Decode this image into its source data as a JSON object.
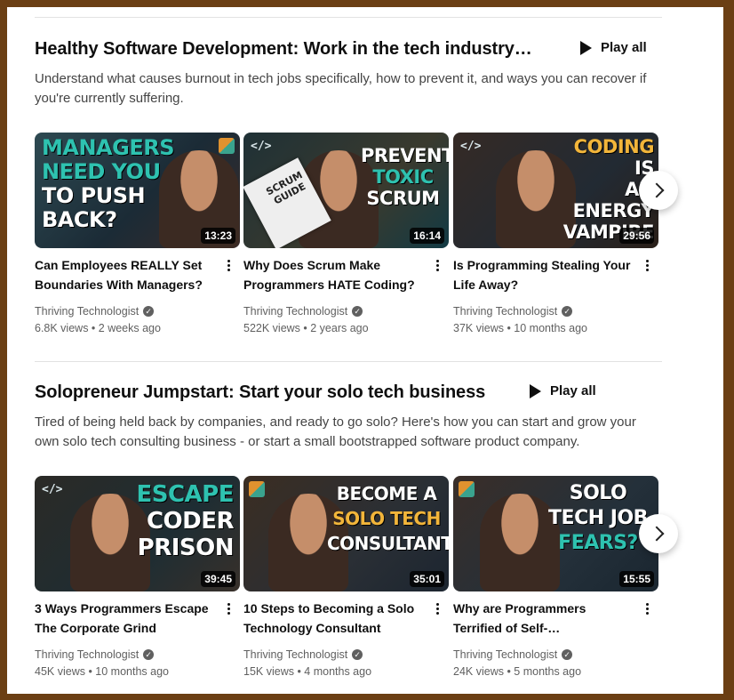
{
  "sections": [
    {
      "title": "Healthy Software Development: Work in the tech industry…",
      "play_all": "Play all",
      "description": "Understand what causes burnout in tech jobs specifically, how to prevent it, and ways you can recover if you're currently suffering.",
      "videos": [
        {
          "title": "Can Employees REALLY Set Boundaries With Managers?",
          "duration": "13:23",
          "channel": "Thriving Technologist",
          "meta": "6.8K views • 2 weeks ago",
          "thumb_lines": [
            "MANAGERS",
            "NEED YOU",
            "TO PUSH",
            "BACK?"
          ]
        },
        {
          "title": "Why Does Scrum Make Programmers HATE Coding?",
          "duration": "16:14",
          "channel": "Thriving Technologist",
          "meta": "522K views • 2 years ago",
          "thumb_lines": [
            "PREVENT",
            "TOXIC",
            "SCRUM"
          ],
          "thumb_note": "SCRUM GUIDE"
        },
        {
          "title": "Is Programming Stealing Your Life Away?",
          "duration": "29:56",
          "channel": "Thriving Technologist",
          "meta": "37K views • 10 months ago",
          "thumb_lines": [
            "CODING",
            "IS",
            "AN ENERGY",
            "VAMPIRE"
          ]
        }
      ]
    },
    {
      "title": "Solopreneur Jumpstart: Start your solo tech business",
      "play_all": "Play all",
      "description": "Tired of being held back by companies, and ready to go solo? Here's how you can start and grow your own solo tech consulting business - or start a small bootstrapped software product company.",
      "videos": [
        {
          "title": "3 Ways Programmers Escape The Corporate Grind",
          "duration": "39:45",
          "channel": "Thriving Technologist",
          "meta": "45K views • 10 months ago",
          "thumb_lines": [
            "ESCAPE",
            "CODER",
            "PRISON"
          ]
        },
        {
          "title": "10 Steps to Becoming a Solo Technology Consultant",
          "duration": "35:01",
          "channel": "Thriving Technologist",
          "meta": "15K views • 4 months ago",
          "thumb_lines": [
            "BECOME A",
            "SOLO TECH",
            "CONSULTANT"
          ]
        },
        {
          "title": "Why are Programmers Terrified of Self-…",
          "duration": "15:55",
          "channel": "Thriving Technologist",
          "meta": "24K views • 5 months ago",
          "thumb_lines": [
            "SOLO",
            "TECH JOB",
            "FEARS?"
          ]
        }
      ]
    }
  ],
  "icons": {
    "verified": "check-circle-icon",
    "kebab": "more-vert-icon",
    "next": "chevron-right-icon",
    "play": "play-icon",
    "code": "code-brackets-icon",
    "logo": "channel-logo-icon"
  },
  "glyphs": {
    "check": "✓",
    "code": "</>"
  },
  "colors": {
    "teal_accent": "#2ec2b0",
    "yellow_accent": "#f2b53a",
    "text_primary": "#0f0f0f",
    "text_secondary": "#606060"
  }
}
